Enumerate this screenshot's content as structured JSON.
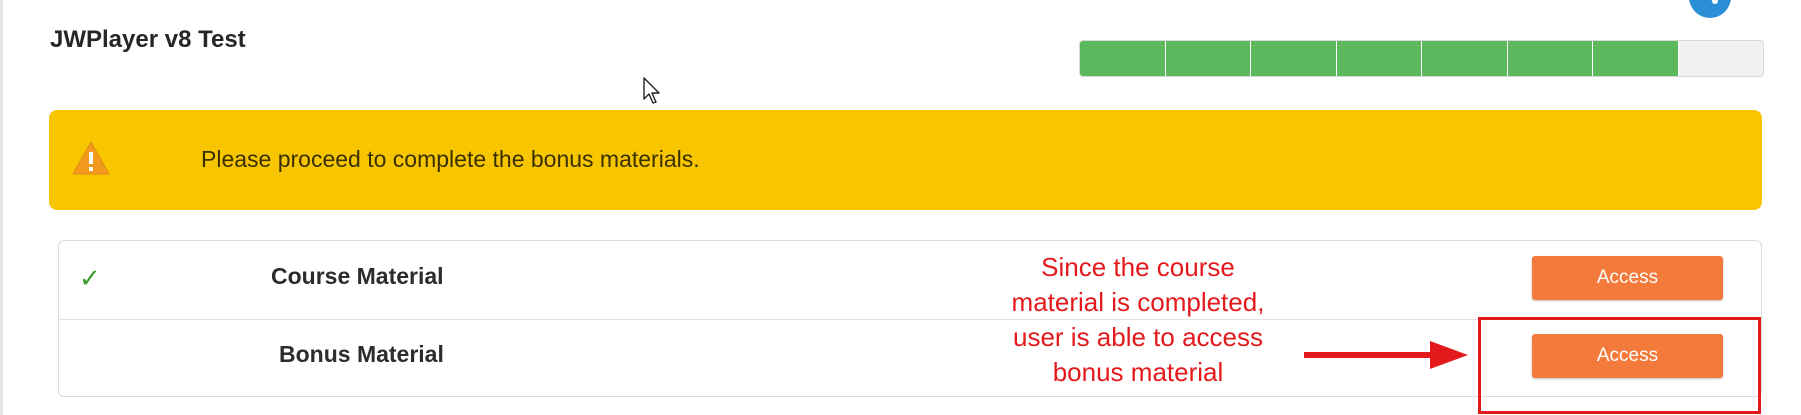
{
  "page": {
    "title": "JWPlayer v8 Test"
  },
  "icons": {
    "share": "share-icon",
    "warning": "warning-icon",
    "check": "checkmark-icon",
    "cursor": "mouse-cursor-icon"
  },
  "progress": {
    "segments_total": 8,
    "segments_completed": 7,
    "complete_color": "#5cb85c",
    "empty_color": "#f1f1f1"
  },
  "alert": {
    "message": "Please proceed to complete the bonus materials.",
    "color": "#f7c600"
  },
  "materials": {
    "rows": [
      {
        "label": "Course Material",
        "completed": true,
        "button_label": "Access"
      },
      {
        "label": "Bonus Material",
        "completed": false,
        "button_label": "Access"
      }
    ],
    "check_glyph": "✓",
    "button_color": "#f47a3b"
  },
  "annotation": {
    "line1": "Since the course",
    "line2": "material is completed,",
    "line3": "user is able to access",
    "line4": "bonus material",
    "color": "#e3191c"
  }
}
